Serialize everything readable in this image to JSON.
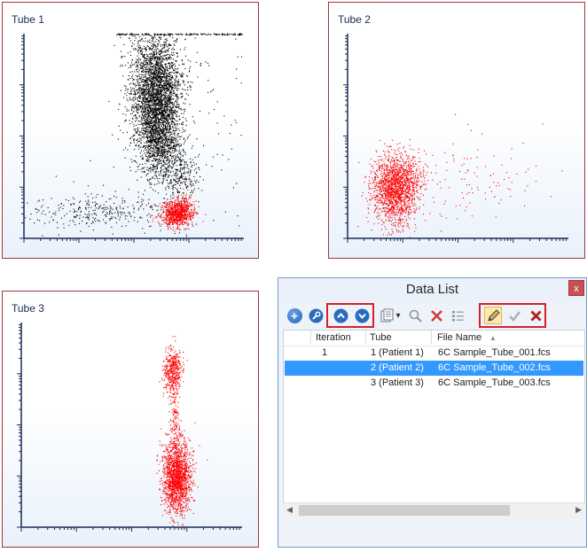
{
  "plots": [
    {
      "title": "Tube 1"
    },
    {
      "title": "Tube 2"
    },
    {
      "title": "Tube 3"
    }
  ],
  "datalist": {
    "title": "Data List",
    "close_label": "x",
    "toolbar": {
      "icons": [
        "add-icon",
        "wrench-icon",
        "move-up-icon",
        "move-down-icon",
        "copy-icon",
        "dropdown-arrow-icon",
        "search-icon",
        "delete-icon",
        "list-settings-icon",
        "edit-pencil-icon",
        "accept-check-icon",
        "cancel-x-icon"
      ],
      "dropdown_glyph": "▾"
    },
    "columns": [
      "Iteration",
      "Tube",
      "File Name"
    ],
    "sort_glyph": "▲",
    "rows": [
      {
        "iteration": "1",
        "tube": "1 (Patient 1)",
        "file": "6C Sample_Tube_001.fcs",
        "selected": false
      },
      {
        "iteration": "",
        "tube": "2 (Patient 2)",
        "file": "6C Sample_Tube_002.fcs",
        "selected": true
      },
      {
        "iteration": "",
        "tube": "3 (Patient 3)",
        "file": "6C Sample_Tube_003.fcs",
        "selected": false
      }
    ],
    "scroll_left": "◀",
    "scroll_right": "▶"
  },
  "colors": {
    "panel_border": "#a4343a",
    "dots_black": "#000000",
    "dots_red": "#ff0000",
    "selection": "#3399ff",
    "highlight_box": "#d8202a"
  }
}
